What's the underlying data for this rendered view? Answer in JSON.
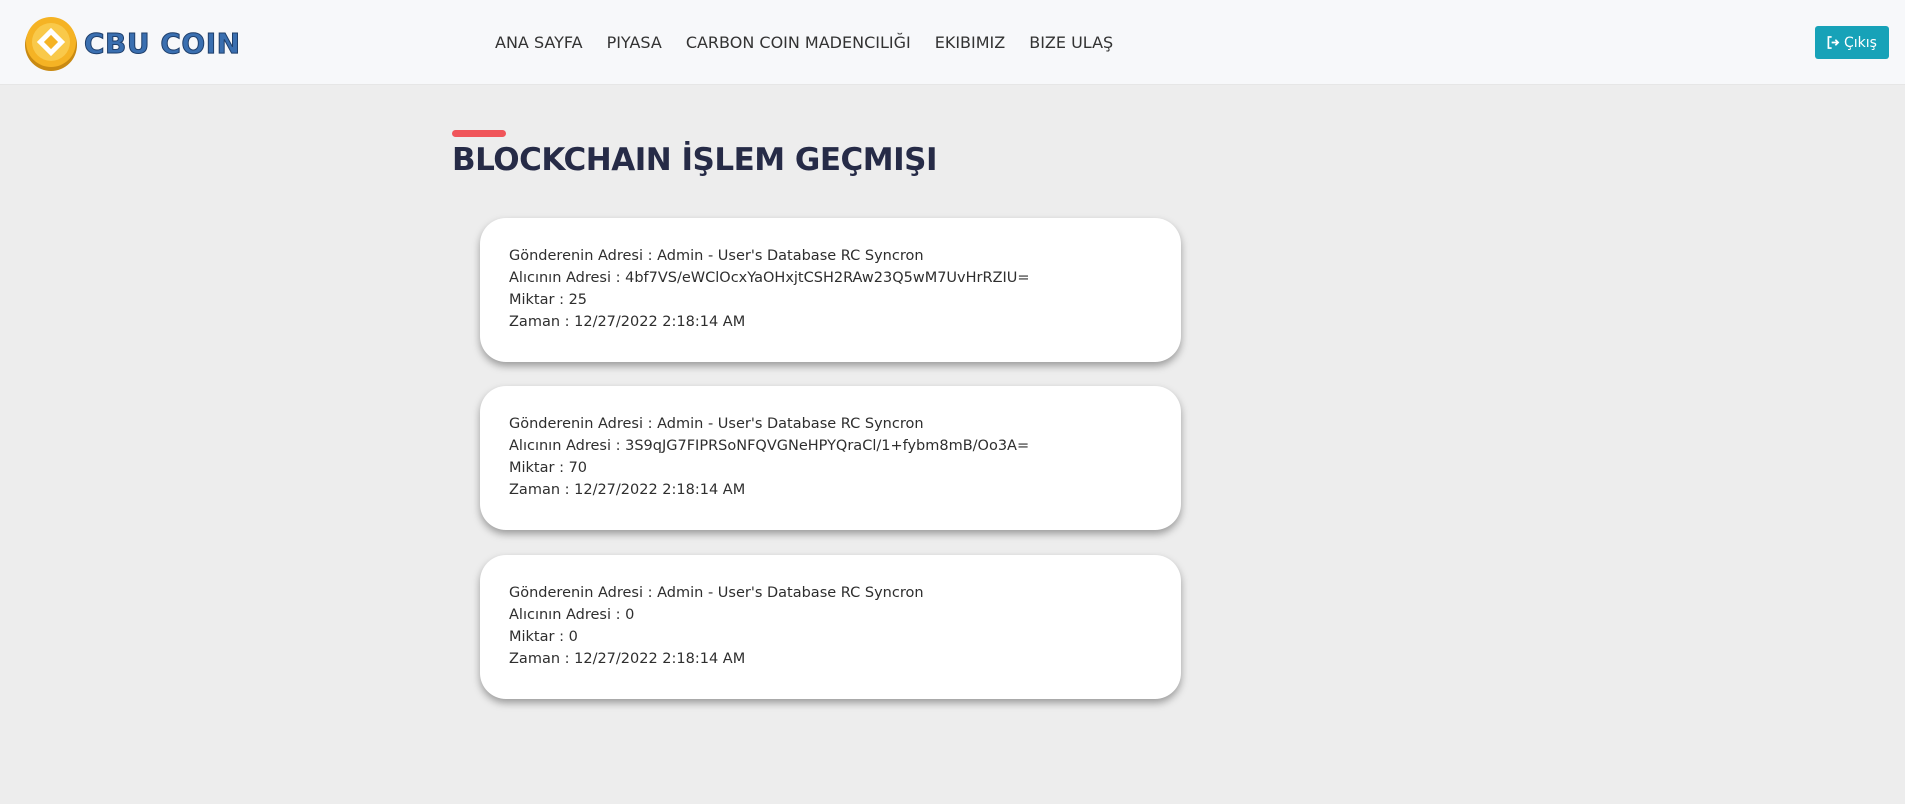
{
  "brand": {
    "name": "CBU COIN"
  },
  "nav": {
    "items": [
      "ANA SAYFA",
      "PIYASA",
      "CARBON COIN MADENCILIĞI",
      "EKIBIMIZ",
      "BIZE ULAŞ"
    ]
  },
  "logout": {
    "label": "Çıkış",
    "icon": "sign-out-icon",
    "color": "#17a2b8"
  },
  "page": {
    "title": "BLOCKCHAIN İŞLEM GEÇMIŞI",
    "accent": "#f0555a"
  },
  "transactions": [
    {
      "sender": "Gönderenin Adresi : Admin - User's Database RC Syncron",
      "receiver": "Alıcının Adresi : 4bf7VS/eWClOcxYaOHxjtCSH2RAw23Q5wM7UvHrRZIU=",
      "amount": "Miktar : 25",
      "time": "Zaman : 12/27/2022 2:18:14 AM"
    },
    {
      "sender": "Gönderenin Adresi : Admin - User's Database RC Syncron",
      "receiver": "Alıcının Adresi : 3S9qJG7FIPRSoNFQVGNeHPYQraCl/1+fybm8mB/Oo3A=",
      "amount": "Miktar : 70",
      "time": "Zaman : 12/27/2022 2:18:14 AM"
    },
    {
      "sender": "Gönderenin Adresi : Admin - User's Database RC Syncron",
      "receiver": "Alıcının Adresi : 0",
      "amount": "Miktar : 0",
      "time": "Zaman : 12/27/2022 2:18:14 AM"
    }
  ]
}
